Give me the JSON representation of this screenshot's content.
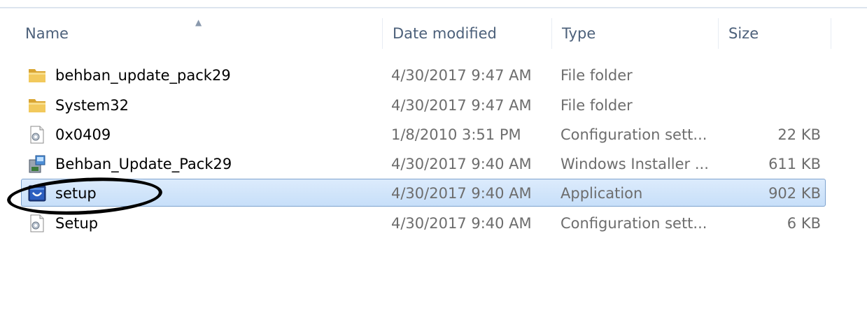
{
  "columns": {
    "name": "Name",
    "date": "Date modified",
    "type": "Type",
    "size": "Size"
  },
  "files": [
    {
      "icon": "folder-icon",
      "name": "behban_update_pack29",
      "date": "4/30/2017 9:47 AM",
      "type": "File folder",
      "size": "",
      "selected": false
    },
    {
      "icon": "folder-icon",
      "name": "System32",
      "date": "4/30/2017 9:47 AM",
      "type": "File folder",
      "size": "",
      "selected": false
    },
    {
      "icon": "config-file-icon",
      "name": "0x0409",
      "date": "1/8/2010 3:51 PM",
      "type": "Configuration sett...",
      "size": "22 KB",
      "selected": false
    },
    {
      "icon": "installer-icon",
      "name": "Behban_Update_Pack29",
      "date": "4/30/2017 9:40 AM",
      "type": "Windows Installer ...",
      "size": "611 KB",
      "selected": false
    },
    {
      "icon": "application-icon",
      "name": "setup",
      "date": "4/30/2017 9:40 AM",
      "type": "Application",
      "size": "902 KB",
      "selected": true
    },
    {
      "icon": "config-file-icon",
      "name": "Setup",
      "date": "4/30/2017 9:40 AM",
      "type": "Configuration sett...",
      "size": "6 KB",
      "selected": false
    }
  ],
  "colors": {
    "selection_border": "#7da2ce",
    "selection_fill": "#cde4fb",
    "folder": "#e8b84a",
    "annotation": "#000000"
  }
}
